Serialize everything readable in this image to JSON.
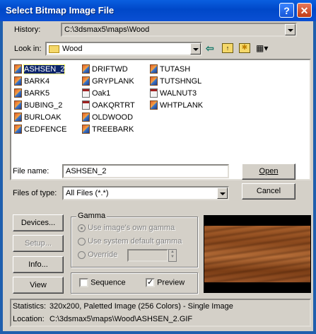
{
  "window": {
    "title": "Select Bitmap Image File",
    "help_label": "?",
    "close_label": "✕"
  },
  "history": {
    "label": "History:",
    "value": "C:\\3dsmax5\\maps\\Wood"
  },
  "look_in": {
    "label": "Look in:",
    "value": "Wood"
  },
  "toolbar": {
    "back_icon": "back-arrow-icon",
    "up_icon": "up-folder-icon",
    "new_folder_icon": "new-folder-icon",
    "view_menu_icon": "view-menu-icon"
  },
  "files": {
    "col1": [
      {
        "name": "ASHSEN_2",
        "type": "gif",
        "selected": true
      },
      {
        "name": "BARK4",
        "type": "gif"
      },
      {
        "name": "BARK5",
        "type": "gif"
      },
      {
        "name": "BUBING_2",
        "type": "gif"
      },
      {
        "name": "BURLOAK",
        "type": "gif"
      },
      {
        "name": "CEDFENCE",
        "type": "gif"
      }
    ],
    "col2": [
      {
        "name": "DRIFTWD",
        "type": "gif"
      },
      {
        "name": "GRYPLANK",
        "type": "gif"
      },
      {
        "name": "Oak1",
        "type": "bmp"
      },
      {
        "name": "OAKQRTRT",
        "type": "bmp"
      },
      {
        "name": "OLDWOOD",
        "type": "gif"
      },
      {
        "name": "TREEBARK",
        "type": "gif"
      }
    ],
    "col3": [
      {
        "name": "TUTASH",
        "type": "gif"
      },
      {
        "name": "TUTSHNGL",
        "type": "gif"
      },
      {
        "name": "WALNUT3",
        "type": "bmp"
      },
      {
        "name": "WHTPLANK",
        "type": "gif"
      }
    ]
  },
  "file_name": {
    "label": "File name:",
    "value": "ASHSEN_2"
  },
  "file_type": {
    "label": "Files of type:",
    "value": "All Files (*.*)"
  },
  "buttons": {
    "open": "Open",
    "cancel": "Cancel",
    "devices": "Devices...",
    "setup": "Setup...",
    "info": "Info...",
    "view": "View"
  },
  "gamma": {
    "title": "Gamma",
    "own": "Use image's own gamma",
    "system": "Use system default gamma",
    "override": "Override"
  },
  "options": {
    "sequence": "Sequence",
    "preview": "Preview",
    "preview_checked": true,
    "sequence_checked": false
  },
  "status": {
    "statistics_label": "Statistics:",
    "statistics_value": "320x200, Paletted Image (256 Colors) - Single Image",
    "location_label": "Location:",
    "location_value": "C:\\3dsmax5\\maps\\Wood\\ASHSEN_2.GIF"
  }
}
